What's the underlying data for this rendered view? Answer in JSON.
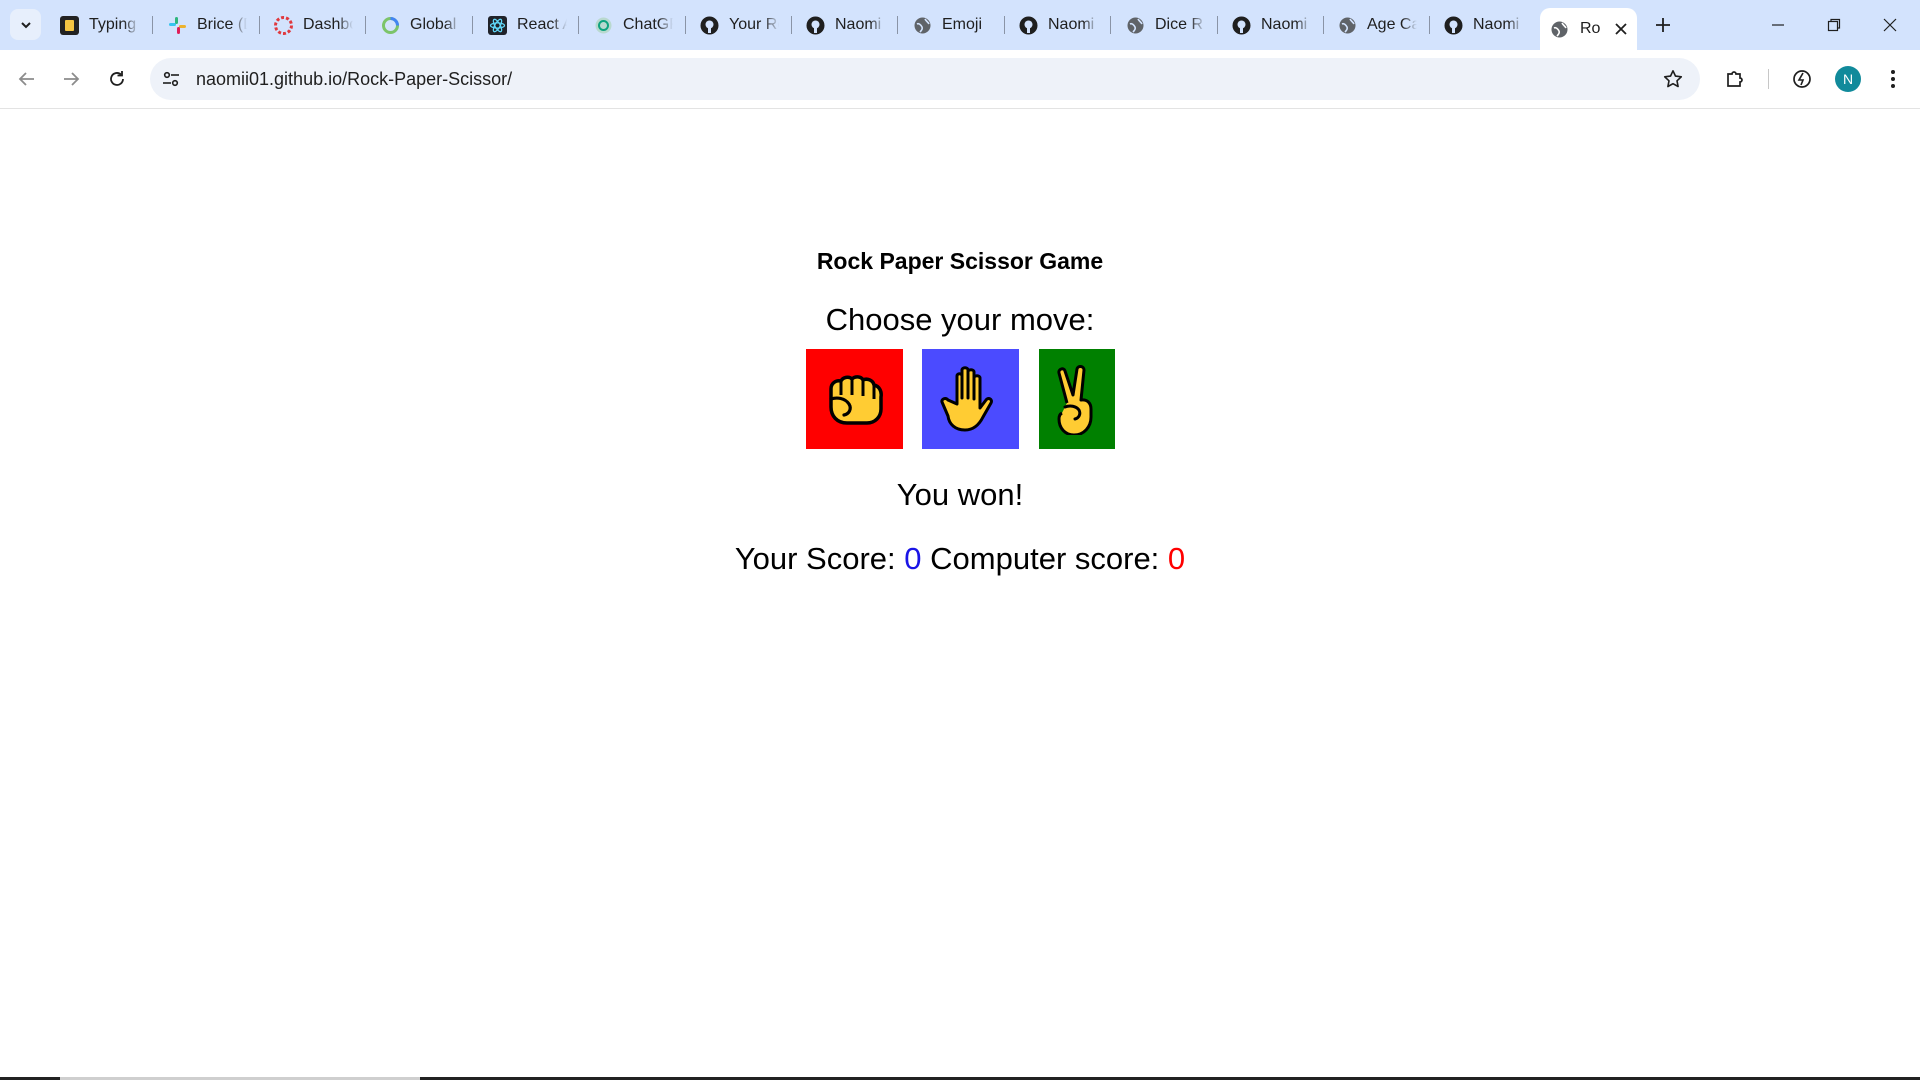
{
  "browser": {
    "tabs": [
      {
        "title": "Typing",
        "favicon": "typing-icon"
      },
      {
        "title": "Brice (D",
        "favicon": "slack-icon"
      },
      {
        "title": "Dashbo",
        "favicon": "dashboard-icon"
      },
      {
        "title": "Global",
        "favicon": "global-icon"
      },
      {
        "title": "React A",
        "favicon": "react-icon"
      },
      {
        "title": "ChatGP",
        "favicon": "chatgpt-icon"
      },
      {
        "title": "Your Re",
        "favicon": "github-icon"
      },
      {
        "title": "Naomi",
        "favicon": "github-icon"
      },
      {
        "title": "Emoji",
        "favicon": "globe-icon"
      },
      {
        "title": "Naomi",
        "favicon": "github-icon"
      },
      {
        "title": "Dice R",
        "favicon": "globe-icon"
      },
      {
        "title": "Naomi",
        "favicon": "github-icon"
      },
      {
        "title": "Age Ca",
        "favicon": "globe-icon"
      },
      {
        "title": "Naomi",
        "favicon": "github-icon"
      }
    ],
    "active_tab": {
      "title": "Ro",
      "favicon": "globe-icon"
    },
    "url": "naomii01.github.io/Rock-Paper-Scissor/",
    "profile_initial": "N"
  },
  "game": {
    "title": "Rock Paper Scissor Game",
    "prompt": "Choose your move:",
    "moves": [
      {
        "name": "Rock",
        "icon": "fist-icon",
        "color": "#ff0000"
      },
      {
        "name": "Paper",
        "icon": "hand-icon",
        "color": "#4b4bff"
      },
      {
        "name": "Scissor",
        "icon": "victory-hand-icon",
        "color": "#008000"
      }
    ],
    "result": "You won!",
    "your_score_label": "Your Score:",
    "your_score": "0",
    "computer_score_label": "Computer score:",
    "computer_score": "0",
    "colors": {
      "your_score": "#1a14e6",
      "computer_score": "#ff0000"
    }
  }
}
